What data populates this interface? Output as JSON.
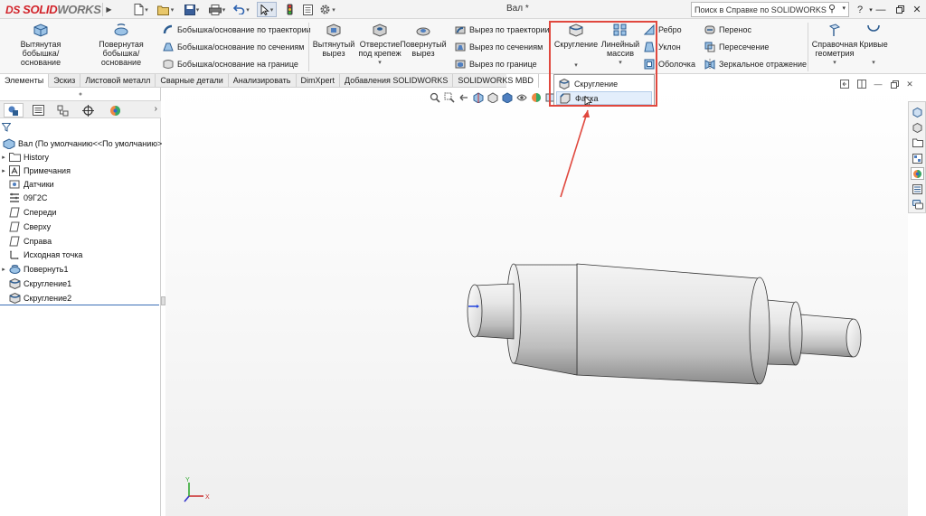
{
  "app": {
    "logo_ds": "DS",
    "logo_part1": "SOLID",
    "logo_part2": "WORKS",
    "document_title": "Вал *",
    "search_placeholder": "Поиск в Справке по SOLIDWORKS"
  },
  "ribbon": {
    "extruded_boss": "Вытянутая\nбобышка/основание",
    "revolved_boss": "Повернутая\nбобышка/основание",
    "swept_boss": "Бобышка/основание по траектории",
    "lofted_boss": "Бобышка/основание по сечениям",
    "boundary_boss": "Бобышка/основание на границе",
    "extruded_cut": "Вытянутый\nвырез",
    "hole_wizard": "Отверстие\nпод крепеж",
    "revolved_cut": "Повернутый\nвырез",
    "swept_cut": "Вырез по траектории",
    "lofted_cut": "Вырез по сечениям",
    "boundary_cut": "Вырез по границе",
    "fillet": "Скругление",
    "linear_pattern": "Линейный\nмассив",
    "rib": "Ребро",
    "draft": "Уклон",
    "shell": "Оболочка",
    "wrap": "Перенос",
    "intersect": "Пересечение",
    "mirror": "Зеркальное отражение",
    "ref_geometry": "Справочная\nгеометрия",
    "curves": "Кривые"
  },
  "tabs": [
    "Элементы",
    "Эскиз",
    "Листовой металл",
    "Сварные детали",
    "Анализировать",
    "DimXpert",
    "Добавления SOLIDWORKS",
    "SOLIDWORKS MBD"
  ],
  "dropdown": {
    "items": [
      "Скругление",
      "Фаска"
    ]
  },
  "tree": {
    "root": "Вал  (По умолчанию<<По умолчанию>",
    "items": [
      "History",
      "Примечания",
      "Датчики",
      "09Г2С",
      "Спереди",
      "Сверху",
      "Справа",
      "Исходная точка",
      "Повернуть1",
      "Скругление1",
      "Скругление2"
    ]
  },
  "triad": {
    "x": "X",
    "y": "Y"
  },
  "colors": {
    "accent_red": "#e0483e",
    "select_blue": "#3b6fb6",
    "brand_red": "#d2232a"
  }
}
